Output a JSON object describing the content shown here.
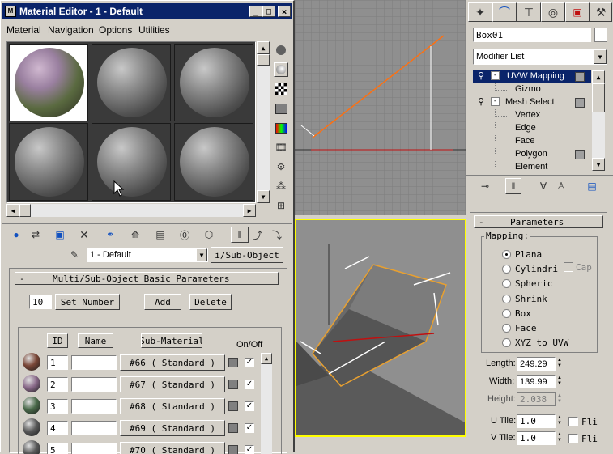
{
  "material_editor": {
    "title": "Material Editor - 1 - Default",
    "menu": [
      "Material",
      "Navigation",
      "Options",
      "Utilities"
    ],
    "material_name": "1 - Default",
    "type_button": "i/Sub-Object",
    "rollout_title": "Multi/Sub-Object Basic Parameters",
    "count": "10",
    "set_number": "Set Number",
    "add": "Add",
    "delete": "Delete",
    "col_id": "ID",
    "col_name": "Name",
    "col_submat": "Sub-Material",
    "col_onoff": "On/Off",
    "rows": [
      {
        "id": "1",
        "mat": "#66  ( Standard )"
      },
      {
        "id": "2",
        "mat": "#67  ( Standard )"
      },
      {
        "id": "3",
        "mat": "#68  ( Standard )"
      },
      {
        "id": "4",
        "mat": "#69  ( Standard )"
      },
      {
        "id": "5",
        "mat": "#70  ( Standard )"
      }
    ]
  },
  "command_panel": {
    "object_name": "Box01",
    "modifier_list": "Modifier List",
    "stack": [
      {
        "label": "UVW Mapping",
        "selected": true
      },
      {
        "label": "Gizmo"
      },
      {
        "label": "Mesh Select"
      },
      {
        "label": "Vertex"
      },
      {
        "label": "Edge"
      },
      {
        "label": "Face"
      },
      {
        "label": "Polygon"
      },
      {
        "label": "Element"
      }
    ],
    "parameters_title": "Parameters",
    "mapping_label": "Mapping:",
    "mapping_options": [
      "Plana",
      "Cylindri",
      "Spheric",
      "Shrink",
      "Box",
      "Face",
      "XYZ to UVW"
    ],
    "cap_label": "Cap",
    "length_label": "Length:",
    "length_value": "249.29",
    "width_label": "Width:",
    "width_value": "139.99",
    "height_label": "Height:",
    "height_value": "2.038",
    "utile_label": "U Tile:",
    "utile_value": "1.0",
    "vtile_label": "V Tile:",
    "vtile_value": "1.0",
    "flip_label": "Fli"
  },
  "colors": {
    "title_bar": "#0a246a",
    "viewport_bg": "#8f8f8f",
    "selection_blue": "#0a246a",
    "active_viewport_border": "#ffff00"
  }
}
